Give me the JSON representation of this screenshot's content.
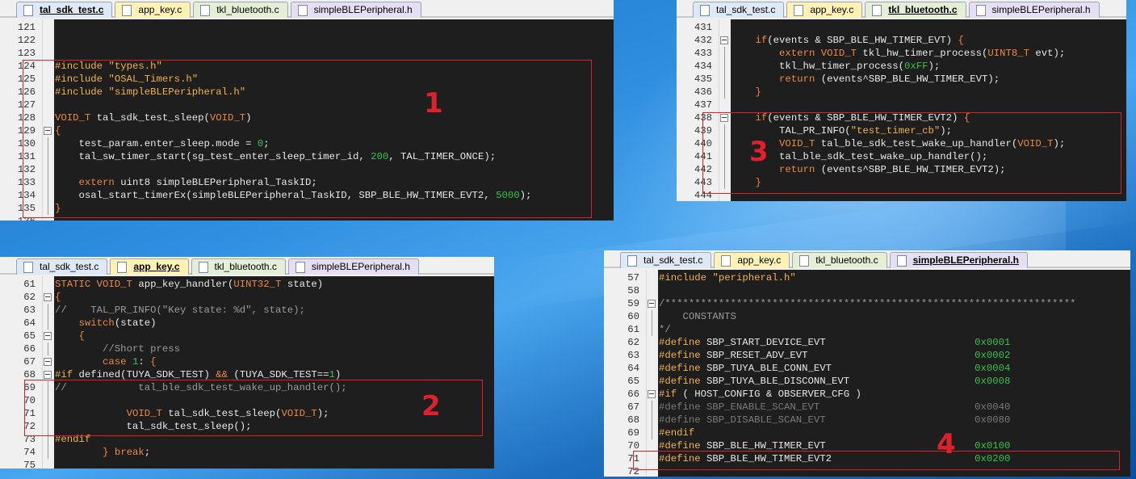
{
  "panels": [
    {
      "id": "p1",
      "tabs": [
        {
          "label": "tal_sdk_test.c",
          "color": "blue",
          "active": true
        },
        {
          "label": "app_key.c",
          "color": "yellow",
          "active": false
        },
        {
          "label": "tkl_bluetooth.c",
          "color": "green",
          "active": false
        },
        {
          "label": "simpleBLEPeripheral.h",
          "color": "purple",
          "active": false
        }
      ],
      "callout": "1",
      "lines": [
        {
          "n": "121",
          "code": ""
        },
        {
          "n": "122",
          "code": ""
        },
        {
          "n": "123",
          "code": ""
        },
        {
          "n": "124",
          "code": "<span class='pp'>#include</span> <span class='str'>\"types.h\"</span>"
        },
        {
          "n": "125",
          "code": "<span class='pp'>#include</span> <span class='str'>\"OSAL_Timers.h\"</span>"
        },
        {
          "n": "126",
          "code": "<span class='pp'>#include</span> <span class='str'>\"simpleBLEPeripheral.h\"</span>"
        },
        {
          "n": "127",
          "code": ""
        },
        {
          "n": "128",
          "code": "<span class='kw'>VOID_T</span> tal_sdk_test_sleep(<span class='kw'>VOID_T</span>)"
        },
        {
          "n": "129",
          "code": "<span class='kw'>{</span>",
          "fold": "box"
        },
        {
          "n": "130",
          "code": "    test_param.enter_sleep.mode = <span class='num'>0</span>;",
          "fold": "line"
        },
        {
          "n": "131",
          "code": "    tal_sw_timer_start(sg_test_enter_sleep_timer_id, <span class='num'>200</span>, TAL_TIMER_ONCE);",
          "fold": "line"
        },
        {
          "n": "132",
          "code": "",
          "fold": "line"
        },
        {
          "n": "133",
          "code": "    <span class='kw'>extern</span> uint8 simpleBLEPeripheral_TaskID;",
          "fold": "line"
        },
        {
          "n": "134",
          "code": "    osal_start_timerEx(simpleBLEPeripheral_TaskID, SBP_BLE_HW_TIMER_EVT2, <span class='num'>5000</span>);",
          "fold": "line"
        },
        {
          "n": "135",
          "code": "<span class='kw'>}</span>",
          "fold": "line"
        },
        {
          "n": "136",
          "code": ""
        }
      ]
    },
    {
      "id": "p2",
      "tabs": [
        {
          "label": "tal_sdk_test.c",
          "color": "blue",
          "active": false
        },
        {
          "label": "app_key.c",
          "color": "yellow",
          "active": true
        },
        {
          "label": "tkl_bluetooth.c",
          "color": "green",
          "active": false
        },
        {
          "label": "simpleBLEPeripheral.h",
          "color": "purple",
          "active": false
        }
      ],
      "callout": "2",
      "lines": [
        {
          "n": "61",
          "code": "<span class='kw'>STATIC VOID_T</span> app_key_handler(<span class='kw'>UINT32_T</span> state)"
        },
        {
          "n": "62",
          "code": "<span class='kw'>{</span>",
          "fold": "box"
        },
        {
          "n": "63",
          "code": "<span class='cmt'>//    TAL_PR_INFO(\"Key state: %d\", state);</span>",
          "fold": "line"
        },
        {
          "n": "64",
          "code": "    <span class='kw'>switch</span>(state)",
          "fold": "line"
        },
        {
          "n": "65",
          "code": "    <span class='kw'>{</span>",
          "fold": "box"
        },
        {
          "n": "66",
          "code": "        <span class='cmt'>//Short press</span>",
          "fold": "line"
        },
        {
          "n": "67",
          "code": "        <span class='kw'>case</span> <span class='num'>1</span>: <span class='kw'>{</span>",
          "fold": "box"
        },
        {
          "n": "68",
          "code": "<span class='pp'>#if</span> defined(TUYA_SDK_TEST) <span class='kw'>&amp;&amp;</span> (TUYA_SDK_TEST==<span class='num'>1</span>)",
          "fold": "box"
        },
        {
          "n": "69",
          "code": "<span class='cmt'>//            tal_ble_sdk_test_wake_up_handler();</span>",
          "fold": "line"
        },
        {
          "n": "70",
          "code": "",
          "fold": "line"
        },
        {
          "n": "71",
          "code": "            <span class='kw'>VOID_T</span> tal_sdk_test_sleep(<span class='kw'>VOID_T</span>);",
          "fold": "line"
        },
        {
          "n": "72",
          "code": "            tal_sdk_test_sleep();",
          "fold": "line"
        },
        {
          "n": "73",
          "code": "<span class='pp'>#endif</span>",
          "fold": "line"
        },
        {
          "n": "74",
          "code": "        <span class='kw'>}</span> <span class='kw'>break</span>;",
          "fold": "line"
        },
        {
          "n": "75",
          "code": ""
        }
      ]
    },
    {
      "id": "p3",
      "tabs": [
        {
          "label": "tal_sdk_test.c",
          "color": "blue",
          "active": false
        },
        {
          "label": "app_key.c",
          "color": "yellow",
          "active": false
        },
        {
          "label": "tkl_bluetooth.c",
          "color": "green",
          "active": true
        },
        {
          "label": "simpleBLEPeripheral.h",
          "color": "purple",
          "active": false
        }
      ],
      "callout": "3",
      "lines": [
        {
          "n": "431",
          "code": ""
        },
        {
          "n": "432",
          "code": "    <span class='kw'>if</span>(events &amp; SBP_BLE_HW_TIMER_EVT) <span class='kw'>{</span>",
          "fold": "box"
        },
        {
          "n": "433",
          "code": "        <span class='kw'>extern VOID_T</span> tkl_hw_timer_process(<span class='kw'>UINT8_T</span> evt);",
          "fold": "line"
        },
        {
          "n": "434",
          "code": "        tkl_hw_timer_process(<span class='num'>0xFF</span>);",
          "fold": "line"
        },
        {
          "n": "435",
          "code": "        <span class='kw'>return</span> (events^SBP_BLE_HW_TIMER_EVT);",
          "fold": "line"
        },
        {
          "n": "436",
          "code": "    <span class='kw'>}</span>",
          "fold": "line"
        },
        {
          "n": "437",
          "code": ""
        },
        {
          "n": "438",
          "code": "    <span class='kw'>if</span>(events &amp; SBP_BLE_HW_TIMER_EVT2) <span class='kw'>{</span>",
          "fold": "box"
        },
        {
          "n": "439",
          "code": "        TAL_PR_INFO(<span class='str'>\"test_timer_cb\"</span>);",
          "fold": "line"
        },
        {
          "n": "440",
          "code": "        <span class='kw'>VOID_T</span> tal_ble_sdk_test_wake_up_handler(<span class='kw'>VOID_T</span>);",
          "fold": "line"
        },
        {
          "n": "441",
          "code": "        tal_ble_sdk_test_wake_up_handler();",
          "fold": "line"
        },
        {
          "n": "442",
          "code": "        <span class='kw'>return</span> (events^SBP_BLE_HW_TIMER_EVT2);",
          "fold": "line"
        },
        {
          "n": "443",
          "code": "    <span class='kw'>}</span>",
          "fold": "line"
        },
        {
          "n": "444",
          "code": ""
        }
      ]
    },
    {
      "id": "p4",
      "tabs": [
        {
          "label": "tal_sdk_test.c",
          "color": "blue",
          "active": false
        },
        {
          "label": "app_key.c",
          "color": "yellow",
          "active": false
        },
        {
          "label": "tkl_bluetooth.c",
          "color": "green",
          "active": false
        },
        {
          "label": "simpleBLEPeripheral.h",
          "color": "purple",
          "active": true
        }
      ],
      "callout": "4",
      "lines": [
        {
          "n": "57",
          "code": "<span class='pp'>#include</span> <span class='str'>\"peripheral.h\"</span>"
        },
        {
          "n": "58",
          "code": ""
        },
        {
          "n": "59",
          "code": "<span class='cmt'>/*********************************************************************</span>",
          "fold": "box"
        },
        {
          "n": "60",
          "code": "<span class='cmt'>    CONSTANTS</span>",
          "fold": "line"
        },
        {
          "n": "61",
          "code": "<span class='cmt'>*/</span>",
          "fold": "line"
        },
        {
          "n": "62",
          "code": "<span class='pp'>#define</span> SBP_START_DEVICE_EVT                         <span class='num'>0x0001</span>"
        },
        {
          "n": "63",
          "code": "<span class='pp'>#define</span> SBP_RESET_ADV_EVT                            <span class='num'>0x0002</span>"
        },
        {
          "n": "64",
          "code": "<span class='pp'>#define</span> SBP_TUYA_BLE_CONN_EVT                        <span class='num'>0x0004</span>"
        },
        {
          "n": "65",
          "code": "<span class='pp'>#define</span> SBP_TUYA_BLE_DISCONN_EVT                     <span class='num'>0x0008</span>"
        },
        {
          "n": "66",
          "code": "<span class='pp'>#if</span> ( HOST_CONFIG &amp; OBSERVER_CFG )",
          "fold": "box"
        },
        {
          "n": "67",
          "code": "<span class='dim'>#define SBP_ENABLE_SCAN_EVT                          0x0040</span>",
          "fold": "line"
        },
        {
          "n": "68",
          "code": "<span class='dim'>#define SBP_DISABLE_SCAN_EVT                         0x0080</span>",
          "fold": "line"
        },
        {
          "n": "69",
          "code": "<span class='pp'>#endif</span>",
          "fold": "line"
        },
        {
          "n": "70",
          "code": "<span class='pp'>#define</span> SBP_BLE_HW_TIMER_EVT                         <span class='num'>0x0100</span>"
        },
        {
          "n": "71",
          "code": "<span class='pp'>#define</span> SBP_BLE_HW_TIMER_EVT2                        <span class='num'>0x0200</span>"
        },
        {
          "n": "72",
          "code": ""
        }
      ]
    }
  ]
}
